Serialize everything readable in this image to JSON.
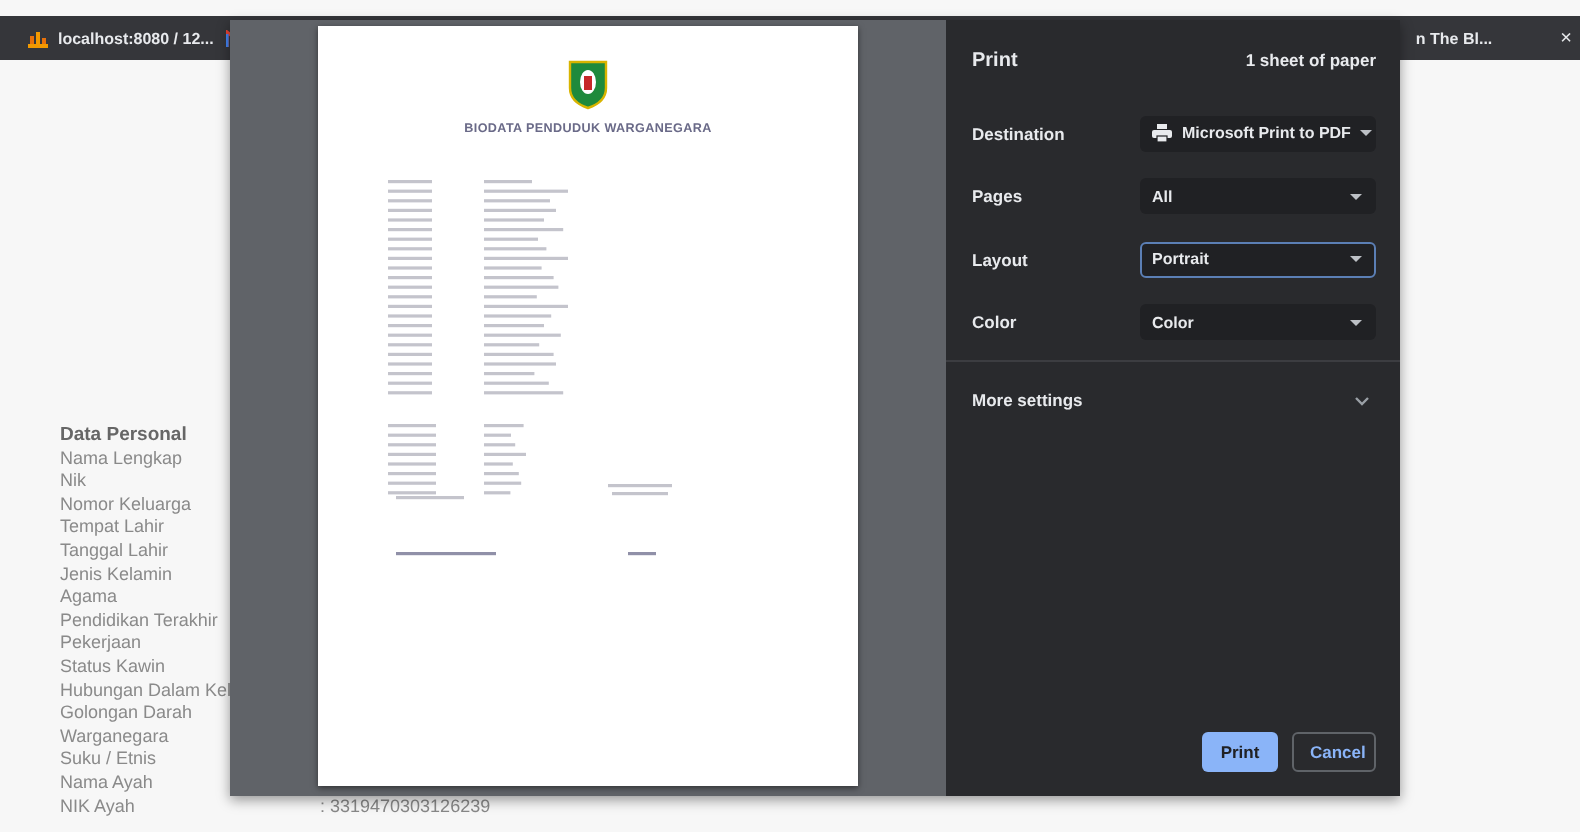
{
  "browser": {
    "tabs": [
      {
        "title": "localhost:8080 / 12...",
        "kind": "site"
      },
      {
        "title": "n The Bl...",
        "kind": "plain"
      }
    ],
    "close_label": "×"
  },
  "page": {
    "section_title": "Data Personal",
    "rows": [
      {
        "label": "Nama Lengkap"
      },
      {
        "label": "Nik"
      },
      {
        "label": "Nomor Keluarga"
      },
      {
        "label": "Tempat Lahir"
      },
      {
        "label": "Tanggal Lahir"
      },
      {
        "label": "Jenis Kelamin"
      },
      {
        "label": "Agama"
      },
      {
        "label": "Pendidikan Terakhir"
      },
      {
        "label": "Pekerjaan"
      },
      {
        "label": "Status Kawin"
      },
      {
        "label": "Hubungan Dalam Kel"
      },
      {
        "label": "Golongan Darah"
      },
      {
        "label": "Warganegara"
      },
      {
        "label": "Suku / Etnis"
      },
      {
        "label": "Nama Ayah"
      },
      {
        "label": "NIK Ayah",
        "value": ": 3319470303126239"
      }
    ]
  },
  "print_dialog": {
    "preview": {
      "title": "BIODATA PENDUDUK WARGANEGARA"
    },
    "title": "Print",
    "sheets": "1 sheet of paper",
    "fields": [
      {
        "label": "Destination",
        "value": "Microsoft Print to PDF",
        "kind": "printer",
        "focused": false
      },
      {
        "label": "Pages",
        "value": "All",
        "kind": "plain",
        "focused": false
      },
      {
        "label": "Layout",
        "value": "Portrait",
        "kind": "plain",
        "focused": true
      },
      {
        "label": "Color",
        "value": "Color",
        "kind": "plain",
        "focused": false
      }
    ],
    "more_settings": {
      "label": "More settings",
      "expanded": false
    },
    "buttons": [
      {
        "label": "Print",
        "kind": "primary"
      },
      {
        "label": "Cancel",
        "kind": "secondary"
      }
    ]
  }
}
